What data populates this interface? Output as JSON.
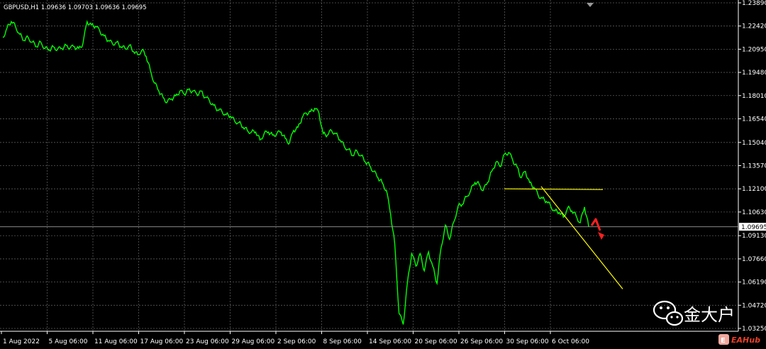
{
  "header": {
    "symbol_info": "GBPUSD,H1  1.09636 1.09703 1.09636 1.09695"
  },
  "watermark": {
    "wechat_icon": "wechat-icon",
    "name": "金大户",
    "logo_text": "EAHub"
  },
  "colors": {
    "background": "#000000",
    "price_line": "#00ff00",
    "grid": "#5a5a5a",
    "trendline": "#ffff00",
    "arrow": "#ff2020",
    "axis_text": "#ffffff"
  },
  "chart_data": {
    "type": "line",
    "title": "",
    "xlabel": "",
    "ylabel": "",
    "grid": true,
    "ylim": [
      1.025,
      1.241
    ],
    "x_ticks": [
      "1 Aug 2022",
      "5 Aug 06:00",
      "11 Aug 06:00",
      "17 Aug 06:00",
      "23 Aug 06:00",
      "29 Aug 06:00",
      "2 Sep 06:00",
      "8 Sep 06:00",
      "14 Sep 06:00",
      "20 Sep 06:00",
      "26 Sep 06:00",
      "30 Sep 06:00",
      "6 Oct 06:00"
    ],
    "y_ticks": [
      "1.23890",
      "1.22420",
      "1.20950",
      "1.19480",
      "1.18010",
      "1.16540",
      "1.15040",
      "1.13570",
      "1.12100",
      "1.10630",
      "1.09130",
      "1.07660",
      "1.06190",
      "1.04720",
      "1.03250"
    ],
    "y_tick_values": [
      1.2389,
      1.2242,
      1.2095,
      1.1948,
      1.1801,
      1.1654,
      1.1504,
      1.1357,
      1.121,
      1.1063,
      1.0913,
      1.0766,
      1.0619,
      1.0472,
      1.0325
    ],
    "current_price": "1.09695",
    "current_price_value": 1.09695,
    "series": [
      {
        "values": [
          1.217,
          1.223,
          1.227,
          1.224,
          1.219,
          1.215,
          1.217,
          1.214,
          1.211,
          1.214,
          1.21,
          1.209,
          1.211,
          1.2095,
          1.21,
          1.212,
          1.2105,
          1.211,
          1.21,
          1.213,
          1.227,
          1.225,
          1.224,
          1.221,
          1.218,
          1.215,
          1.213,
          1.214,
          1.211,
          1.21,
          1.212,
          1.208,
          1.206,
          1.209,
          1.205,
          1.196,
          1.188,
          1.183,
          1.179,
          1.176,
          1.178,
          1.18,
          1.183,
          1.181,
          1.184,
          1.183,
          1.181,
          1.183,
          1.179,
          1.177,
          1.174,
          1.171,
          1.17,
          1.168,
          1.167,
          1.164,
          1.163,
          1.16,
          1.158,
          1.157,
          1.157,
          1.152,
          1.156,
          1.157,
          1.155,
          1.156,
          1.157,
          1.153,
          1.15,
          1.158,
          1.16,
          1.166,
          1.169,
          1.17,
          1.172,
          1.169,
          1.156,
          1.155,
          1.158,
          1.156,
          1.152,
          1.148,
          1.146,
          1.142,
          1.145,
          1.142,
          1.138,
          1.136,
          1.132,
          1.128,
          1.125,
          1.12,
          1.105,
          1.086,
          1.042,
          1.035,
          1.062,
          1.08,
          1.072,
          1.08,
          1.069,
          1.081,
          1.072,
          1.061,
          1.084,
          1.098,
          1.089,
          1.1,
          1.11,
          1.111,
          1.116,
          1.12,
          1.125,
          1.124,
          1.12,
          1.125,
          1.132,
          1.138,
          1.135,
          1.143,
          1.144,
          1.139,
          1.135,
          1.128,
          1.132,
          1.125,
          1.122,
          1.117,
          1.115,
          1.113,
          1.11,
          1.107,
          1.106,
          1.103,
          1.109,
          1.107,
          1.104,
          1.0995,
          1.1095,
          1.097
        ],
        "color": "#00ff00"
      }
    ],
    "annotations": [
      {
        "kind": "horizontal_line",
        "price": 1.121,
        "x_from": "Sep 30",
        "x_to": "Oct 11",
        "color": "#ffff00"
      },
      {
        "kind": "trend_line",
        "from_price": 1.1225,
        "to_price": 1.0575,
        "color": "#ffff00"
      },
      {
        "kind": "arrow",
        "direction": "down",
        "color": "#ff2020"
      }
    ]
  }
}
